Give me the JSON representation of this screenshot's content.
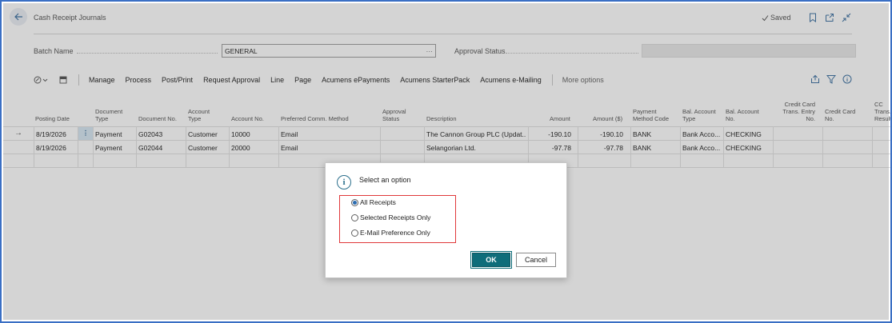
{
  "header": {
    "title": "Cash Receipt Journals",
    "saved_label": "Saved"
  },
  "fields": {
    "batch_name_label": "Batch Name",
    "batch_name_value": "GENERAL",
    "batch_name_lookup": "···",
    "approval_status_label": "Approval Status"
  },
  "actionbar": {
    "items": [
      "Manage",
      "Process",
      "Post/Print",
      "Request Approval",
      "Line",
      "Page",
      "Acumens ePayments",
      "Acumens StarterPack",
      "Acumens e-Mailing"
    ],
    "more": "More options"
  },
  "grid": {
    "columns": {
      "posting_date": "Posting Date",
      "doc_type_1": "Document",
      "doc_type_2": "Type",
      "doc_no": "Document No.",
      "acct_type_1": "Account",
      "acct_type_2": "Type",
      "acct_no": "Account No.",
      "comm": "Preferred Comm. Method",
      "appr_1": "Approval",
      "appr_2": "Status",
      "desc": "Description",
      "amount": "Amount",
      "amount_usd": "Amount ($)",
      "pay_1": "Payment",
      "pay_2": "Method Code",
      "bal_type_1": "Bal. Account",
      "bal_type_2": "Type",
      "bal_no_1": "Bal. Account",
      "bal_no_2": "No.",
      "cc_entry_1": "Credit Card",
      "cc_entry_2": "Trans. Entry",
      "cc_entry_3": "No.",
      "cc_no_1": "Credit Card",
      "cc_no_2": "No.",
      "cc_res_1": "CC",
      "cc_res_2": "Trans.",
      "cc_res_3": "Result"
    },
    "rows": [
      {
        "date": "8/19/2026",
        "doc_type": "Payment",
        "doc_no": "G02043",
        "acct_type": "Customer",
        "acct_no": "10000",
        "comm": "Email",
        "desc": "The Cannon Group PLC (Updat...",
        "amount": "-190.10",
        "amount_usd": "-190.10",
        "pay": "BANK",
        "bal_type": "Bank Acco...",
        "bal_no": "CHECKING"
      },
      {
        "date": "8/19/2026",
        "doc_type": "Payment",
        "doc_no": "G02044",
        "acct_type": "Customer",
        "acct_no": "20000",
        "comm": "Email",
        "desc": "Selangorian Ltd.",
        "amount": "-97.78",
        "amount_usd": "-97.78",
        "pay": "BANK",
        "bal_type": "Bank Acco...",
        "bal_no": "CHECKING"
      }
    ]
  },
  "dialog": {
    "title": "Select an option",
    "options": [
      "All Receipts",
      "Selected Receipts Only",
      "E-Mail Preference Only"
    ],
    "selected_index": 0,
    "ok": "OK",
    "cancel": "Cancel"
  },
  "colors": {
    "accent": "#0f6d7a",
    "highlight": "#e0383a",
    "frame": "#3a6fc4"
  }
}
